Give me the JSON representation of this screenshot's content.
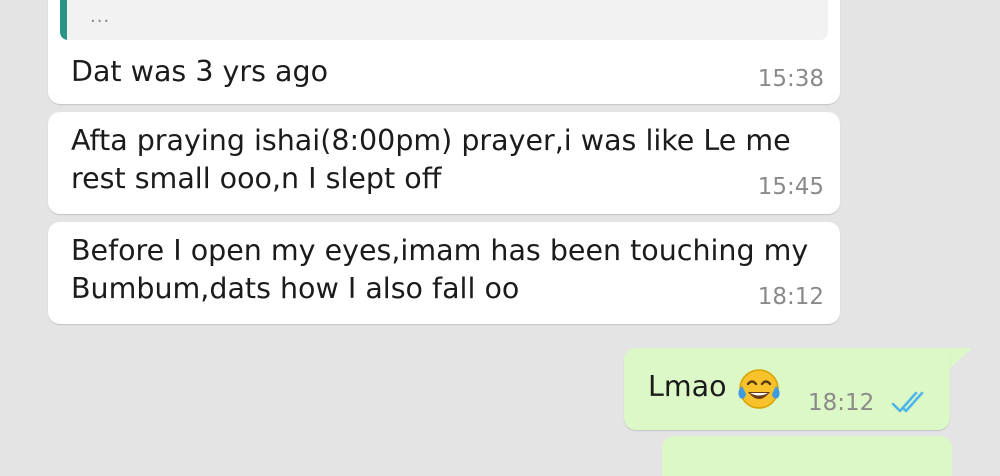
{
  "quoted": {
    "preview": "..."
  },
  "messages_in": [
    {
      "text": "Dat was 3 yrs ago",
      "time": "15:38"
    },
    {
      "text": "Afta praying ishai(8:00pm) prayer,i was like Le me\nrest small ooo,n I slept off",
      "time": "15:45"
    },
    {
      "text": "Before I open my eyes,imam has been touching my\nBumbum,dats how I also fall oo",
      "time": "18:12"
    }
  ],
  "message_out": {
    "text": "Lmao",
    "emoji": "face-with-tears-of-joy-icon",
    "time": "18:12",
    "status": "read-double-check-icon"
  },
  "colors": {
    "background": "#e4e4e4",
    "incoming_bubble": "#ffffff",
    "outgoing_bubble": "#dcf8c6",
    "quote_bar": "#2b9585",
    "read_ticks": "#4fb6ec",
    "timestamp": "#8a8a8a"
  }
}
